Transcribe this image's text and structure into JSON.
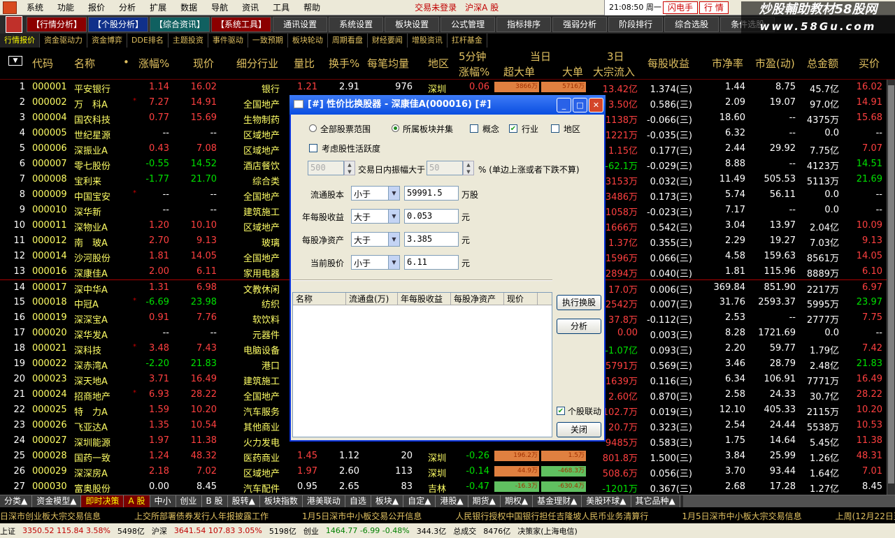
{
  "menu": {
    "items": [
      "系统",
      "功能",
      "报价",
      "分析",
      "扩展",
      "数据",
      "导航",
      "资讯",
      "工具",
      "帮助"
    ],
    "status": "交易未登录",
    "market": "沪深A 股",
    "clock": "21:08:50 周一",
    "hot_btn": "闪电手",
    "quote_btn": "行 情"
  },
  "brand": {
    "line1": "炒股輔助教材58股网",
    "line2": "www.58Gu.com"
  },
  "toolbar": {
    "tabs": [
      "【行情分析】",
      "【个股分析】",
      "【综合资讯】",
      "【系统工具】"
    ],
    "buttons": [
      "通讯设置",
      "系统设置",
      "板块设置",
      "公式管理",
      "指标排序",
      "强弱分析",
      "阶段排行",
      "综合选股",
      "条件选股"
    ]
  },
  "subtabs": [
    "行情报价",
    "资金驱动力",
    "资金博弈",
    "DDE排名",
    "主题投资",
    "事件驱动",
    "一致预期",
    "板块轮动",
    "周期看盘",
    "财经要闻",
    "增股资讯",
    "扛杆基金"
  ],
  "headers": {
    "code": "代码",
    "name": "名称",
    "dot": "•",
    "chg": "涨幅%",
    "price": "现价",
    "ind": "细分行业",
    "vr": "量比",
    "tr": "换手%",
    "avg": "每笔均量",
    "reg": "地区",
    "m5a": "5分钟",
    "m5b": "涨幅%",
    "today": "当日",
    "xl": "超大单",
    "lg": "大单",
    "d3a": "3日",
    "d3b": "大宗流入",
    "eps": "每股收益",
    "pb": "市净率",
    "pe": "市盈(动)",
    "amt": "总金额",
    "bid": "买价"
  },
  "rows": [
    {
      "n": "1",
      "code": "000001",
      "name": "平安银行",
      "m": "",
      "chg": "1.14",
      "price": "16.02",
      "ind": "银行",
      "vr": "1.21",
      "tr": "2.91",
      "avg": "976",
      "reg": "深圳",
      "m5": "0.06",
      "b1": "3866万",
      "b2": "5716万",
      "d3": "13.42亿",
      "eps": "1.374(三)",
      "pb": "1.44",
      "pe": "8.75",
      "amt": "45.7亿",
      "bid": "16.02",
      "dir": "up"
    },
    {
      "n": "2",
      "code": "000002",
      "name": "万　科A",
      "m": "*",
      "chg": "7.27",
      "price": "14.91",
      "ind": "全国地产",
      "vr": "",
      "tr": "",
      "avg": "",
      "reg": "",
      "m5": "",
      "b1": "",
      "b2": "",
      "d3": "3.50亿",
      "eps": "0.586(三)",
      "pb": "2.09",
      "pe": "19.07",
      "amt": "97.0亿",
      "bid": "14.91",
      "dir": "up"
    },
    {
      "n": "3",
      "code": "000004",
      "name": "国农科技",
      "m": "",
      "chg": "0.77",
      "price": "15.69",
      "ind": "生物制药",
      "vr": "",
      "tr": "",
      "avg": "",
      "reg": "",
      "m5": "",
      "b1": "",
      "b2": "",
      "d3": "1138万",
      "eps": "-0.066(三)",
      "pb": "18.60",
      "pe": "--",
      "amt": "4375万",
      "bid": "15.68",
      "dir": "up"
    },
    {
      "n": "4",
      "code": "000005",
      "name": "世纪星源",
      "m": "",
      "chg": "--",
      "price": "--",
      "ind": "区域地产",
      "vr": "",
      "tr": "",
      "avg": "",
      "reg": "",
      "m5": "",
      "b1": "",
      "b2": "",
      "d3": "1221万",
      "eps": "-0.035(三)",
      "pb": "6.32",
      "pe": "--",
      "amt": "0.0",
      "bid": "--",
      "dir": "flat"
    },
    {
      "n": "5",
      "code": "000006",
      "name": "深振业A",
      "m": "",
      "chg": "0.43",
      "price": "7.08",
      "ind": "区域地产",
      "vr": "",
      "tr": "",
      "avg": "",
      "reg": "",
      "m5": "",
      "b1": "",
      "b2": "",
      "d3": "1.15亿",
      "eps": "0.177(三)",
      "pb": "2.44",
      "pe": "29.92",
      "amt": "7.75亿",
      "bid": "7.07",
      "dir": "up"
    },
    {
      "n": "6",
      "code": "000007",
      "name": "零七股份",
      "m": "",
      "chg": "-0.55",
      "price": "14.52",
      "ind": "酒店餐饮",
      "vr": "",
      "tr": "",
      "avg": "",
      "reg": "",
      "m5": "",
      "b1": "",
      "b2": "",
      "d3": "-62.1万",
      "eps": "-0.029(三)",
      "pb": "8.88",
      "pe": "--",
      "amt": "4123万",
      "bid": "14.51",
      "dir": "dn"
    },
    {
      "n": "7",
      "code": "000008",
      "name": "宝利来",
      "m": "",
      "chg": "-1.77",
      "price": "21.70",
      "ind": "综合类",
      "vr": "",
      "tr": "",
      "avg": "",
      "reg": "",
      "m5": "",
      "b1": "",
      "b2": "",
      "d3": "3153万",
      "eps": "0.032(三)",
      "pb": "11.49",
      "pe": "505.53",
      "amt": "5113万",
      "bid": "21.69",
      "dir": "dn"
    },
    {
      "n": "8",
      "code": "000009",
      "name": "中国宝安",
      "m": "*",
      "chg": "--",
      "price": "--",
      "ind": "全国地产",
      "vr": "",
      "tr": "",
      "avg": "",
      "reg": "",
      "m5": "",
      "b1": "",
      "b2": "",
      "d3": "3486万",
      "eps": "0.173(三)",
      "pb": "5.74",
      "pe": "56.11",
      "amt": "0.0",
      "bid": "--",
      "dir": "flat"
    },
    {
      "n": "9",
      "code": "000010",
      "name": "深华新",
      "m": "",
      "chg": "--",
      "price": "--",
      "ind": "建筑施工",
      "vr": "",
      "tr": "",
      "avg": "",
      "reg": "",
      "m5": "",
      "b1": "",
      "b2": "",
      "d3": "1058万",
      "eps": "-0.023(三)",
      "pb": "7.17",
      "pe": "--",
      "amt": "0.0",
      "bid": "--",
      "dir": "flat"
    },
    {
      "n": "10",
      "code": "000011",
      "name": "深物业A",
      "m": "",
      "chg": "1.20",
      "price": "10.10",
      "ind": "区域地产",
      "vr": "",
      "tr": "",
      "avg": "",
      "reg": "",
      "m5": "",
      "b1": "",
      "b2": "",
      "d3": "1666万",
      "eps": "0.542(三)",
      "pb": "3.04",
      "pe": "13.97",
      "amt": "2.04亿",
      "bid": "10.09",
      "dir": "up"
    },
    {
      "n": "11",
      "code": "000012",
      "name": "南　玻A",
      "m": "",
      "chg": "2.70",
      "price": "9.13",
      "ind": "玻璃",
      "vr": "",
      "tr": "",
      "avg": "",
      "reg": "",
      "m5": "",
      "b1": "",
      "b2": "",
      "d3": "1.37亿",
      "eps": "0.355(三)",
      "pb": "2.29",
      "pe": "19.27",
      "amt": "7.03亿",
      "bid": "9.13",
      "dir": "up"
    },
    {
      "n": "12",
      "code": "000014",
      "name": "沙河股份",
      "m": "",
      "chg": "1.81",
      "price": "14.05",
      "ind": "全国地产",
      "vr": "",
      "tr": "",
      "avg": "",
      "reg": "",
      "m5": "",
      "b1": "",
      "b2": "",
      "d3": "1596万",
      "eps": "0.066(三)",
      "pb": "4.58",
      "pe": "159.63",
      "amt": "8561万",
      "bid": "14.05",
      "dir": "up"
    },
    {
      "n": "13",
      "code": "000016",
      "name": "深康佳A",
      "m": "",
      "chg": "2.00",
      "price": "6.11",
      "ind": "家用电器",
      "vr": "",
      "tr": "",
      "avg": "",
      "reg": "",
      "m5": "",
      "b1": "",
      "b2": "",
      "d3": "2894万",
      "eps": "0.040(三)",
      "pb": "1.81",
      "pe": "115.96",
      "amt": "8889万",
      "bid": "6.10",
      "dir": "up"
    },
    {
      "n": "14",
      "code": "000017",
      "name": "深中华A",
      "m": "",
      "chg": "1.31",
      "price": "6.98",
      "ind": "文教休闲",
      "vr": "",
      "tr": "",
      "avg": "",
      "reg": "",
      "m5": "",
      "b1": "",
      "b2": "",
      "d3": "17.0万",
      "eps": "0.006(三)",
      "pb": "369.84",
      "pe": "851.90",
      "amt": "2217万",
      "bid": "6.97",
      "dir": "up"
    },
    {
      "n": "15",
      "code": "000018",
      "name": "中冠A",
      "m": "*",
      "chg": "-6.69",
      "price": "23.98",
      "ind": "纺织",
      "vr": "",
      "tr": "",
      "avg": "",
      "reg": "",
      "m5": "",
      "b1": "",
      "b2": "",
      "d3": "2542万",
      "eps": "0.007(三)",
      "pb": "31.76",
      "pe": "2593.37",
      "amt": "5995万",
      "bid": "23.97",
      "dir": "dn"
    },
    {
      "n": "16",
      "code": "000019",
      "name": "深深宝A",
      "m": "",
      "chg": "0.91",
      "price": "7.76",
      "ind": "软饮料",
      "vr": "",
      "tr": "",
      "avg": "",
      "reg": "",
      "m5": "",
      "b1": "",
      "b2": "",
      "d3": "37.8万",
      "eps": "-0.112(三)",
      "pb": "2.53",
      "pe": "--",
      "amt": "2777万",
      "bid": "7.75",
      "dir": "up"
    },
    {
      "n": "17",
      "code": "000020",
      "name": "深华发A",
      "m": "",
      "chg": "--",
      "price": "--",
      "ind": "元器件",
      "vr": "",
      "tr": "",
      "avg": "",
      "reg": "",
      "m5": "",
      "b1": "",
      "b2": "",
      "d3": "0.00",
      "eps": "0.003(三)",
      "pb": "8.28",
      "pe": "1721.69",
      "amt": "0.0",
      "bid": "--",
      "dir": "flat"
    },
    {
      "n": "18",
      "code": "000021",
      "name": "深科技",
      "m": "*",
      "chg": "3.48",
      "price": "7.43",
      "ind": "电脑设备",
      "vr": "",
      "tr": "",
      "avg": "",
      "reg": "",
      "m5": "",
      "b1": "",
      "b2": "",
      "d3": "-1.07亿",
      "eps": "0.093(三)",
      "pb": "2.20",
      "pe": "59.77",
      "amt": "1.79亿",
      "bid": "7.42",
      "dir": "up"
    },
    {
      "n": "19",
      "code": "000022",
      "name": "深赤湾A",
      "m": "",
      "chg": "-2.20",
      "price": "21.83",
      "ind": "港口",
      "vr": "",
      "tr": "",
      "avg": "",
      "reg": "",
      "m5": "",
      "b1": "",
      "b2": "",
      "d3": "5791万",
      "eps": "0.569(三)",
      "pb": "3.46",
      "pe": "28.79",
      "amt": "2.48亿",
      "bid": "21.83",
      "dir": "dn"
    },
    {
      "n": "20",
      "code": "000023",
      "name": "深天地A",
      "m": "",
      "chg": "3.71",
      "price": "16.49",
      "ind": "建筑施工",
      "vr": "",
      "tr": "",
      "avg": "",
      "reg": "",
      "m5": "",
      "b1": "",
      "b2": "",
      "d3": "1639万",
      "eps": "0.116(三)",
      "pb": "6.34",
      "pe": "106.91",
      "amt": "7771万",
      "bid": "16.49",
      "dir": "up"
    },
    {
      "n": "21",
      "code": "000024",
      "name": "招商地产",
      "m": "*",
      "chg": "6.93",
      "price": "28.22",
      "ind": "全国地产",
      "vr": "",
      "tr": "",
      "avg": "",
      "reg": "",
      "m5": "",
      "b1": "",
      "b2": "",
      "d3": "2.60亿",
      "eps": "0.870(三)",
      "pb": "2.58",
      "pe": "24.33",
      "amt": "30.7亿",
      "bid": "28.22",
      "dir": "up"
    },
    {
      "n": "22",
      "code": "000025",
      "name": "特　力A",
      "m": "",
      "chg": "1.59",
      "price": "10.20",
      "ind": "汽车服务",
      "vr": "",
      "tr": "",
      "avg": "",
      "reg": "",
      "m5": "",
      "b1": "",
      "b2": "",
      "d3": "102.7万",
      "eps": "0.019(三)",
      "pb": "12.10",
      "pe": "405.33",
      "amt": "2115万",
      "bid": "10.20",
      "dir": "up"
    },
    {
      "n": "23",
      "code": "000026",
      "name": "飞亚达A",
      "m": "",
      "chg": "1.35",
      "price": "10.54",
      "ind": "其他商业",
      "vr": "",
      "tr": "",
      "avg": "",
      "reg": "",
      "m5": "",
      "b1": "",
      "b2": "",
      "d3": "20.7万",
      "eps": "0.323(三)",
      "pb": "2.54",
      "pe": "24.44",
      "amt": "5538万",
      "bid": "10.53",
      "dir": "up"
    },
    {
      "n": "24",
      "code": "000027",
      "name": "深圳能源",
      "m": "",
      "chg": "1.97",
      "price": "11.38",
      "ind": "火力发电",
      "vr": "",
      "tr": "",
      "avg": "",
      "reg": "",
      "m5": "",
      "b1": "",
      "b2": "",
      "d3": "9485万",
      "eps": "0.583(三)",
      "pb": "1.75",
      "pe": "14.64",
      "amt": "5.45亿",
      "bid": "11.38",
      "dir": "up"
    },
    {
      "n": "25",
      "code": "000028",
      "name": "国药一致",
      "m": "",
      "chg": "1.24",
      "price": "48.32",
      "ind": "医药商业",
      "vr": "1.45",
      "tr": "1.12",
      "avg": "20",
      "reg": "深圳",
      "m5": "-0.26",
      "b1": "196.2万",
      "b2": "1.5万",
      "d3": "801.8万",
      "eps": "1.500(三)",
      "pb": "3.84",
      "pe": "25.99",
      "amt": "1.26亿",
      "bid": "48.31",
      "dir": "up"
    },
    {
      "n": "26",
      "code": "000029",
      "name": "深深房A",
      "m": "",
      "chg": "2.18",
      "price": "7.02",
      "ind": "区域地产",
      "vr": "1.97",
      "tr": "2.60",
      "avg": "113",
      "reg": "深圳",
      "m5": "-0.14",
      "b1": "44.9万",
      "b2": "-468.3万",
      "d3": "508.6万",
      "eps": "0.056(三)",
      "pb": "3.70",
      "pe": "93.44",
      "amt": "1.64亿",
      "bid": "7.01",
      "dir": "up"
    },
    {
      "n": "27",
      "code": "000030",
      "name": "富奥股份",
      "m": "",
      "chg": "0.00",
      "price": "8.45",
      "ind": "汽车配件",
      "vr": "0.95",
      "tr": "2.65",
      "avg": "83",
      "reg": "吉林",
      "m5": "-0.47",
      "b1": "-16.3万",
      "b2": "-630.4万",
      "d3": "-1201万",
      "eps": "0.367(三)",
      "pb": "2.68",
      "pe": "17.28",
      "amt": "1.27亿",
      "bid": "8.45",
      "dir": "flat"
    }
  ],
  "dialog": {
    "title": "[#] 性价比换股器 - 深康佳A(000016) [#]",
    "scope_all": "全部股票范围",
    "scope_sector": "所属板块并集",
    "concept": "概念",
    "industry": "行业",
    "region": "地区",
    "activity": "考虑股性活跃度",
    "amp_a": "500",
    "amp_label": "交易日内振幅大于",
    "amp_b": "50",
    "amp_note": "% (单边上涨或者下跌不算)",
    "f1_label": "流通股本",
    "f1_op": "小于",
    "f1_val": "59991.5",
    "f1_unit": "万股",
    "f2_label": "年每股收益",
    "f2_op": "大于",
    "f2_val": "0.053",
    "f2_unit": "元",
    "f3_label": "每股净资产",
    "f3_op": "大于",
    "f3_val": "3.385",
    "f3_unit": "元",
    "f4_label": "当前股价",
    "f4_op": "小于",
    "f4_val": "6.11",
    "f4_unit": "元",
    "cols": [
      "名称",
      "流通盘(万)",
      "年每股收益",
      "每股净资产",
      "现价"
    ],
    "exec": "执行换股",
    "analyze": "分析",
    "link": "个股联动",
    "close": "关闭"
  },
  "bottom_tabs": [
    "分类▲",
    "资金模型▲",
    "即时决策",
    "A 股",
    "中小",
    "创业",
    "B 股",
    "股转▲",
    "板块指数",
    "港美联动",
    "自选",
    "板块▲",
    "自定▲",
    "港股▲",
    "期货▲",
    "期权▲",
    "基金理财▲",
    "美股环球▲",
    "其它品种▲"
  ],
  "ticker": [
    "日深市创业板大宗交易信息",
    "上交所部署债券发行人年报披露工作",
    "1月5日深市中小板交易公开信息",
    "人民银行授权中国银行担任吉隆坡人民币业务清算行",
    "1月5日深市中小板大宗交易信息",
    "上周(12月22日至28日)"
  ],
  "statusbar": {
    "sh_label": "上证",
    "sh": "3350.52 115.84 3.58%",
    "sh_amt": "5498亿",
    "sz_label": "沪深",
    "sz": "3641.54 107.83 3.05%",
    "sz_amt": "5198亿",
    "cy_label": "创业",
    "cy": "1464.77 -6.99 -0.48%",
    "cy_amt": "344.3亿",
    "deal": "总成交",
    "deal_amt": "8476亿",
    "app": "决策家(上海电信)"
  },
  "colors": {
    "up": "#ff4040",
    "down": "#00e000",
    "header": "#e0c060",
    "name": "#ffff66"
  }
}
